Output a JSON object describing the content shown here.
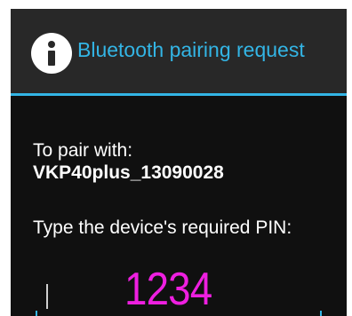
{
  "dialog": {
    "title": "Bluetooth pairing request",
    "title_icon": "info-icon",
    "accent_color": "#33b5e5",
    "pair_label": "To pair with:",
    "device_name": "VKP40plus_13090028",
    "pin_prompt": "Type the device's required PIN:",
    "pin_value": "1234",
    "pin_color": "#ee1fe0"
  }
}
